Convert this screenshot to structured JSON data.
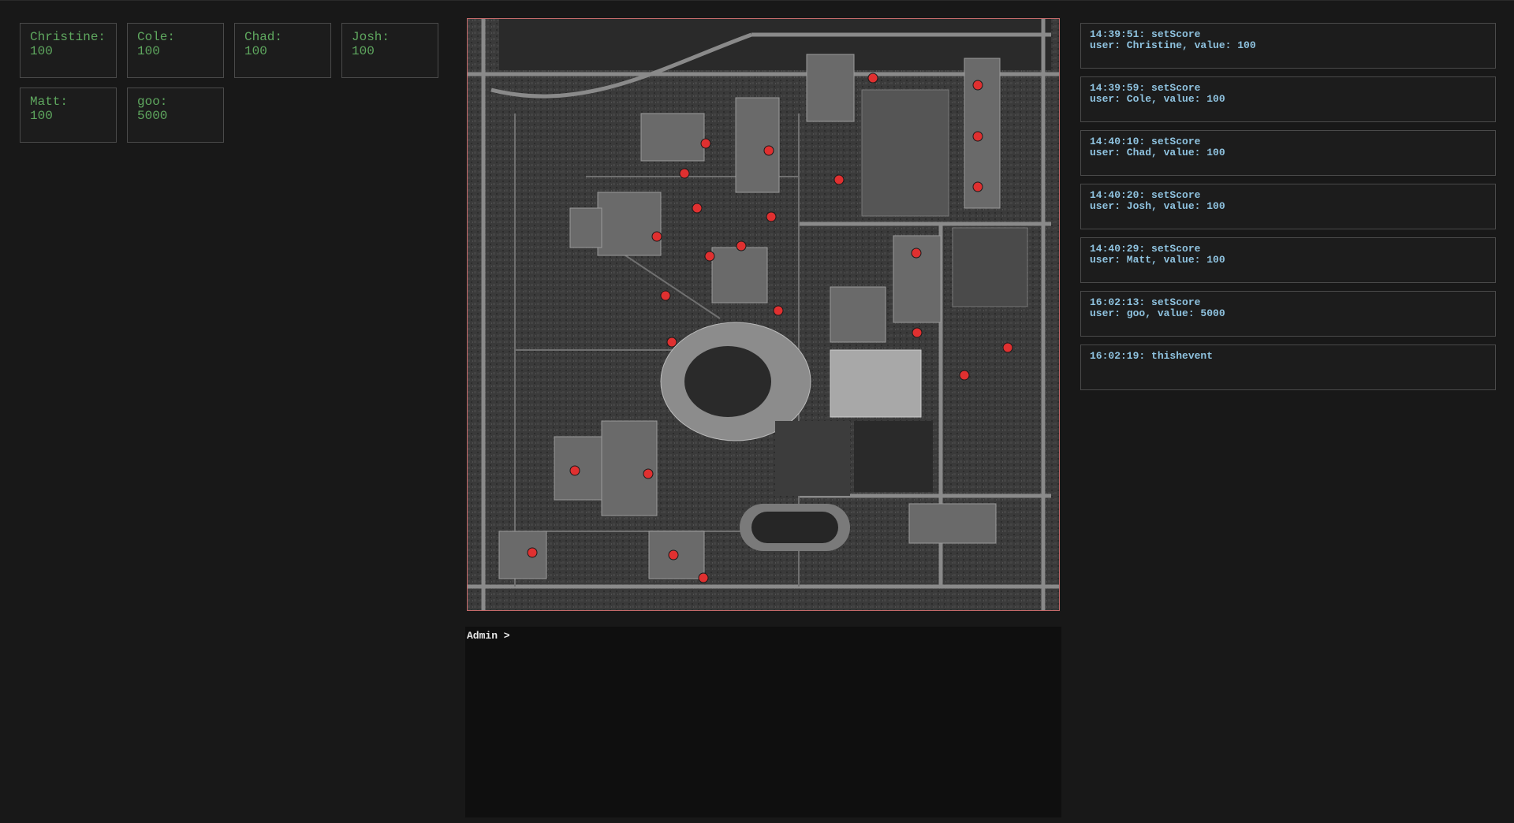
{
  "scores": [
    {
      "name": "Christine:",
      "value": "100"
    },
    {
      "name": "Cole:",
      "value": "100"
    },
    {
      "name": "Chad:",
      "value": "100"
    },
    {
      "name": "Josh:",
      "value": "100"
    },
    {
      "name": "Matt:",
      "value": "100"
    },
    {
      "name": "goo:",
      "value": "5000"
    }
  ],
  "map": {
    "marker_color": "#e03030",
    "border_color": "#c46a6a"
  },
  "console": {
    "prompt": "Admin >"
  },
  "log": [
    {
      "line1": "14:39:51: setScore",
      "line2": "user: Christine, value: 100"
    },
    {
      "line1": "14:39:59: setScore",
      "line2": "user: Cole, value: 100"
    },
    {
      "line1": "14:40:10: setScore",
      "line2": "user: Chad, value: 100"
    },
    {
      "line1": "14:40:20: setScore",
      "line2": "user: Josh, value: 100"
    },
    {
      "line1": "14:40:29: setScore",
      "line2": "user: Matt, value: 100"
    },
    {
      "line1": "16:02:13: setScore",
      "line2": "user: goo, value: 5000"
    },
    {
      "line1": "16:02:19: thishevent",
      "line2": ""
    }
  ]
}
